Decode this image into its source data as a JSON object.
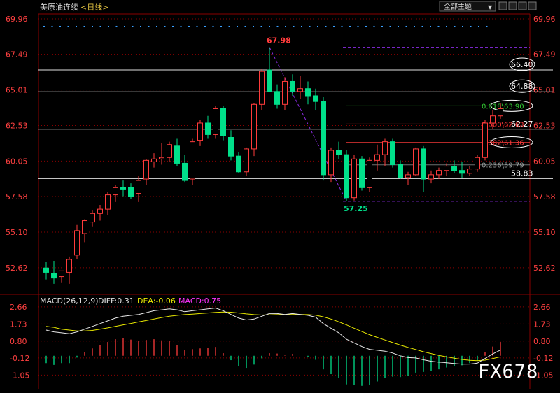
{
  "header": {
    "instrument": "美原油连续",
    "period": "<日线>",
    "theme_label": "全部主题",
    "theme_caret": "▼",
    "icon_names": [
      "grid-icon",
      "list-icon",
      "minimize-icon",
      "close-icon"
    ]
  },
  "watermark": "FX678",
  "colors": {
    "up": "#ff3b3b",
    "down": "#00e08a",
    "dif_line": "#e8e8e8",
    "dea_line": "#e8e800",
    "macd_label": "#ff33ff",
    "axis_text": "#ff4040",
    "fib_line": "#8a2be2",
    "grid": "#8a0000"
  },
  "chart_data": [
    {
      "type": "candlestick",
      "title": "美原油连续 <日线>",
      "ylim": [
        51.2,
        70.3
      ],
      "y_ticks": [
        "69.96",
        "67.49",
        "65.01",
        "62.53",
        "60.05",
        "57.58",
        "55.10",
        "52.62"
      ],
      "candles": [
        [
          52.6,
          53.0,
          51.8,
          52.3
        ],
        [
          52.2,
          53.1,
          51.5,
          51.9
        ],
        [
          52.0,
          52.4,
          51.6,
          52.4
        ],
        [
          52.3,
          53.4,
          51.5,
          53.2
        ],
        [
          53.5,
          55.6,
          53.2,
          55.2
        ],
        [
          55.0,
          56.0,
          54.4,
          55.9
        ],
        [
          55.8,
          56.6,
          55.5,
          56.4
        ],
        [
          56.4,
          57.0,
          55.9,
          56.7
        ],
        [
          56.7,
          57.9,
          56.3,
          57.7
        ],
        [
          57.7,
          58.4,
          57.2,
          58.2
        ],
        [
          58.2,
          58.7,
          57.6,
          58.1
        ],
        [
          58.2,
          58.5,
          57.4,
          57.6
        ],
        [
          57.8,
          59.0,
          57.2,
          58.7
        ],
        [
          58.8,
          60.2,
          58.4,
          60.1
        ],
        [
          60.0,
          60.6,
          59.6,
          60.2
        ],
        [
          60.2,
          61.3,
          59.8,
          60.3
        ],
        [
          60.3,
          61.4,
          60.0,
          61.2
        ],
        [
          61.1,
          61.6,
          59.7,
          59.9
        ],
        [
          59.9,
          60.5,
          58.6,
          58.7
        ],
        [
          58.8,
          61.6,
          58.4,
          61.4
        ],
        [
          61.5,
          62.9,
          61.1,
          62.7
        ],
        [
          62.7,
          63.2,
          61.6,
          61.9
        ],
        [
          61.9,
          63.9,
          61.6,
          63.7
        ],
        [
          63.7,
          63.9,
          61.5,
          61.8
        ],
        [
          61.7,
          62.2,
          60.1,
          60.4
        ],
        [
          60.4,
          60.7,
          59.2,
          59.3
        ],
        [
          59.3,
          61.0,
          59.0,
          60.9
        ],
        [
          60.9,
          64.1,
          60.4,
          64.0
        ],
        [
          64.0,
          66.5,
          63.6,
          66.3
        ],
        [
          66.4,
          67.98,
          65.0,
          64.9
        ],
        [
          64.9,
          65.4,
          63.7,
          64.0
        ],
        [
          64.0,
          65.9,
          63.6,
          65.6
        ],
        [
          65.6,
          66.1,
          64.6,
          64.9
        ],
        [
          64.9,
          66.0,
          64.4,
          65.1
        ],
        [
          65.1,
          65.6,
          64.0,
          64.6
        ],
        [
          64.6,
          65.1,
          63.6,
          64.2
        ],
        [
          64.2,
          64.5,
          58.7,
          59.1
        ],
        [
          59.1,
          61.0,
          58.6,
          60.8
        ],
        [
          60.8,
          61.4,
          60.2,
          60.5
        ],
        [
          60.5,
          60.8,
          57.25,
          57.5
        ],
        [
          57.5,
          60.5,
          57.3,
          60.2
        ],
        [
          60.2,
          60.4,
          58.0,
          58.2
        ],
        [
          58.2,
          60.3,
          57.9,
          60.1
        ],
        [
          60.1,
          61.2,
          59.4,
          60.5
        ],
        [
          60.5,
          61.6,
          59.7,
          61.4
        ],
        [
          61.4,
          61.6,
          59.6,
          59.8
        ],
        [
          59.8,
          60.1,
          58.8,
          58.9
        ],
        [
          58.9,
          59.3,
          58.4,
          59.1
        ],
        [
          59.1,
          61.0,
          59.0,
          60.9
        ],
        [
          60.9,
          61.1,
          57.9,
          58.8
        ],
        [
          58.8,
          59.4,
          58.5,
          59.1
        ],
        [
          59.1,
          59.6,
          58.8,
          59.4
        ],
        [
          59.4,
          59.9,
          59.0,
          59.7
        ],
        [
          59.7,
          60.1,
          59.2,
          59.4
        ],
        [
          59.4,
          60.0,
          58.9,
          59.2
        ],
        [
          59.2,
          59.7,
          59.0,
          59.5
        ],
        [
          59.5,
          60.5,
          59.3,
          60.3
        ],
        [
          60.3,
          62.9,
          60.1,
          62.7
        ],
        [
          62.7,
          63.6,
          62.3,
          63.2
        ],
        [
          63.2,
          64.1,
          63.0,
          63.7
        ]
      ],
      "horizontal_levels": [
        {
          "value": 66.4,
          "label": "66.40",
          "circled": true
        },
        {
          "value": 64.88,
          "label": "64.88",
          "circled": true
        },
        {
          "value": 62.27,
          "label": "62.27",
          "circled": false
        },
        {
          "value": 58.83,
          "label": "58.83",
          "circled": false
        }
      ],
      "fibonacci": {
        "high": 67.98,
        "low": 57.25,
        "levels": [
          {
            "value": 63.9,
            "label": "0.618\\63.90",
            "color": "#33cc33",
            "circled": true
          },
          {
            "value": 62.63,
            "label": "0.500\\62.63",
            "color": "#ff3b3b",
            "circled": false
          },
          {
            "value": 61.36,
            "label": "0.382\\61.36",
            "color": "#ff3b3b",
            "circled": true
          },
          {
            "value": 59.79,
            "label": "0.236\\59.79",
            "color": "#9aa0a0",
            "circled": false
          }
        ]
      },
      "current_price": 63.6,
      "annotations": [
        {
          "text": "67.98",
          "value": 67.98,
          "candle": 29,
          "color": "#ff3b3b"
        },
        {
          "text": "57.25",
          "value": 57.25,
          "candle": 39,
          "color": "#00e08a"
        }
      ]
    },
    {
      "type": "macd",
      "title": "MACD(26,12,9)",
      "diff_label": "DIFF:0.31",
      "dea_label": "DEA:-0.06",
      "macd_label": "MACD:0.75",
      "ylim": [
        -1.8,
        3.0
      ],
      "y_ticks": [
        "2.66",
        "1.73",
        "0.80",
        "-0.12",
        "-1.05"
      ],
      "diff": [
        1.4,
        1.3,
        1.25,
        1.2,
        1.3,
        1.45,
        1.6,
        1.75,
        1.9,
        2.05,
        2.15,
        2.2,
        2.25,
        2.35,
        2.45,
        2.5,
        2.55,
        2.5,
        2.4,
        2.45,
        2.5,
        2.55,
        2.6,
        2.45,
        2.25,
        2.05,
        1.95,
        2.0,
        2.15,
        2.3,
        2.3,
        2.25,
        2.3,
        2.25,
        2.2,
        2.1,
        1.75,
        1.5,
        1.25,
        0.9,
        0.7,
        0.5,
        0.35,
        0.3,
        0.25,
        0.15,
        0.0,
        -0.1,
        -0.12,
        -0.22,
        -0.3,
        -0.35,
        -0.38,
        -0.42,
        -0.46,
        -0.45,
        -0.4,
        -0.15,
        0.1,
        0.31
      ],
      "dea": [
        1.6,
        1.55,
        1.45,
        1.4,
        1.35,
        1.35,
        1.38,
        1.45,
        1.52,
        1.6,
        1.68,
        1.76,
        1.84,
        1.92,
        2.0,
        2.08,
        2.15,
        2.2,
        2.24,
        2.27,
        2.3,
        2.33,
        2.36,
        2.38,
        2.37,
        2.33,
        2.28,
        2.24,
        2.22,
        2.23,
        2.24,
        2.24,
        2.25,
        2.25,
        2.24,
        2.21,
        2.12,
        2.0,
        1.85,
        1.68,
        1.5,
        1.32,
        1.15,
        1.0,
        0.86,
        0.72,
        0.58,
        0.45,
        0.34,
        0.22,
        0.12,
        0.02,
        -0.06,
        -0.13,
        -0.2,
        -0.25,
        -0.27,
        -0.24,
        -0.15,
        -0.06
      ],
      "histogram": [
        -0.4,
        -0.5,
        -0.4,
        -0.4,
        -0.1,
        0.2,
        0.4,
        0.6,
        0.75,
        0.9,
        0.95,
        0.88,
        0.82,
        0.86,
        0.9,
        0.84,
        0.8,
        0.6,
        0.32,
        0.36,
        0.4,
        0.44,
        0.48,
        0.14,
        -0.24,
        -0.56,
        -0.66,
        -0.48,
        -0.14,
        0.14,
        0.12,
        0.02,
        0.1,
        0.0,
        -0.08,
        -0.22,
        -0.74,
        -1.0,
        -1.2,
        -1.56,
        -1.6,
        -1.64,
        -1.6,
        -1.4,
        -1.22,
        -1.14,
        -1.16,
        -1.1,
        -0.92,
        -0.88,
        -0.84,
        -0.74,
        -0.64,
        -0.58,
        -0.52,
        -0.4,
        -0.26,
        0.18,
        0.5,
        0.75
      ]
    }
  ]
}
